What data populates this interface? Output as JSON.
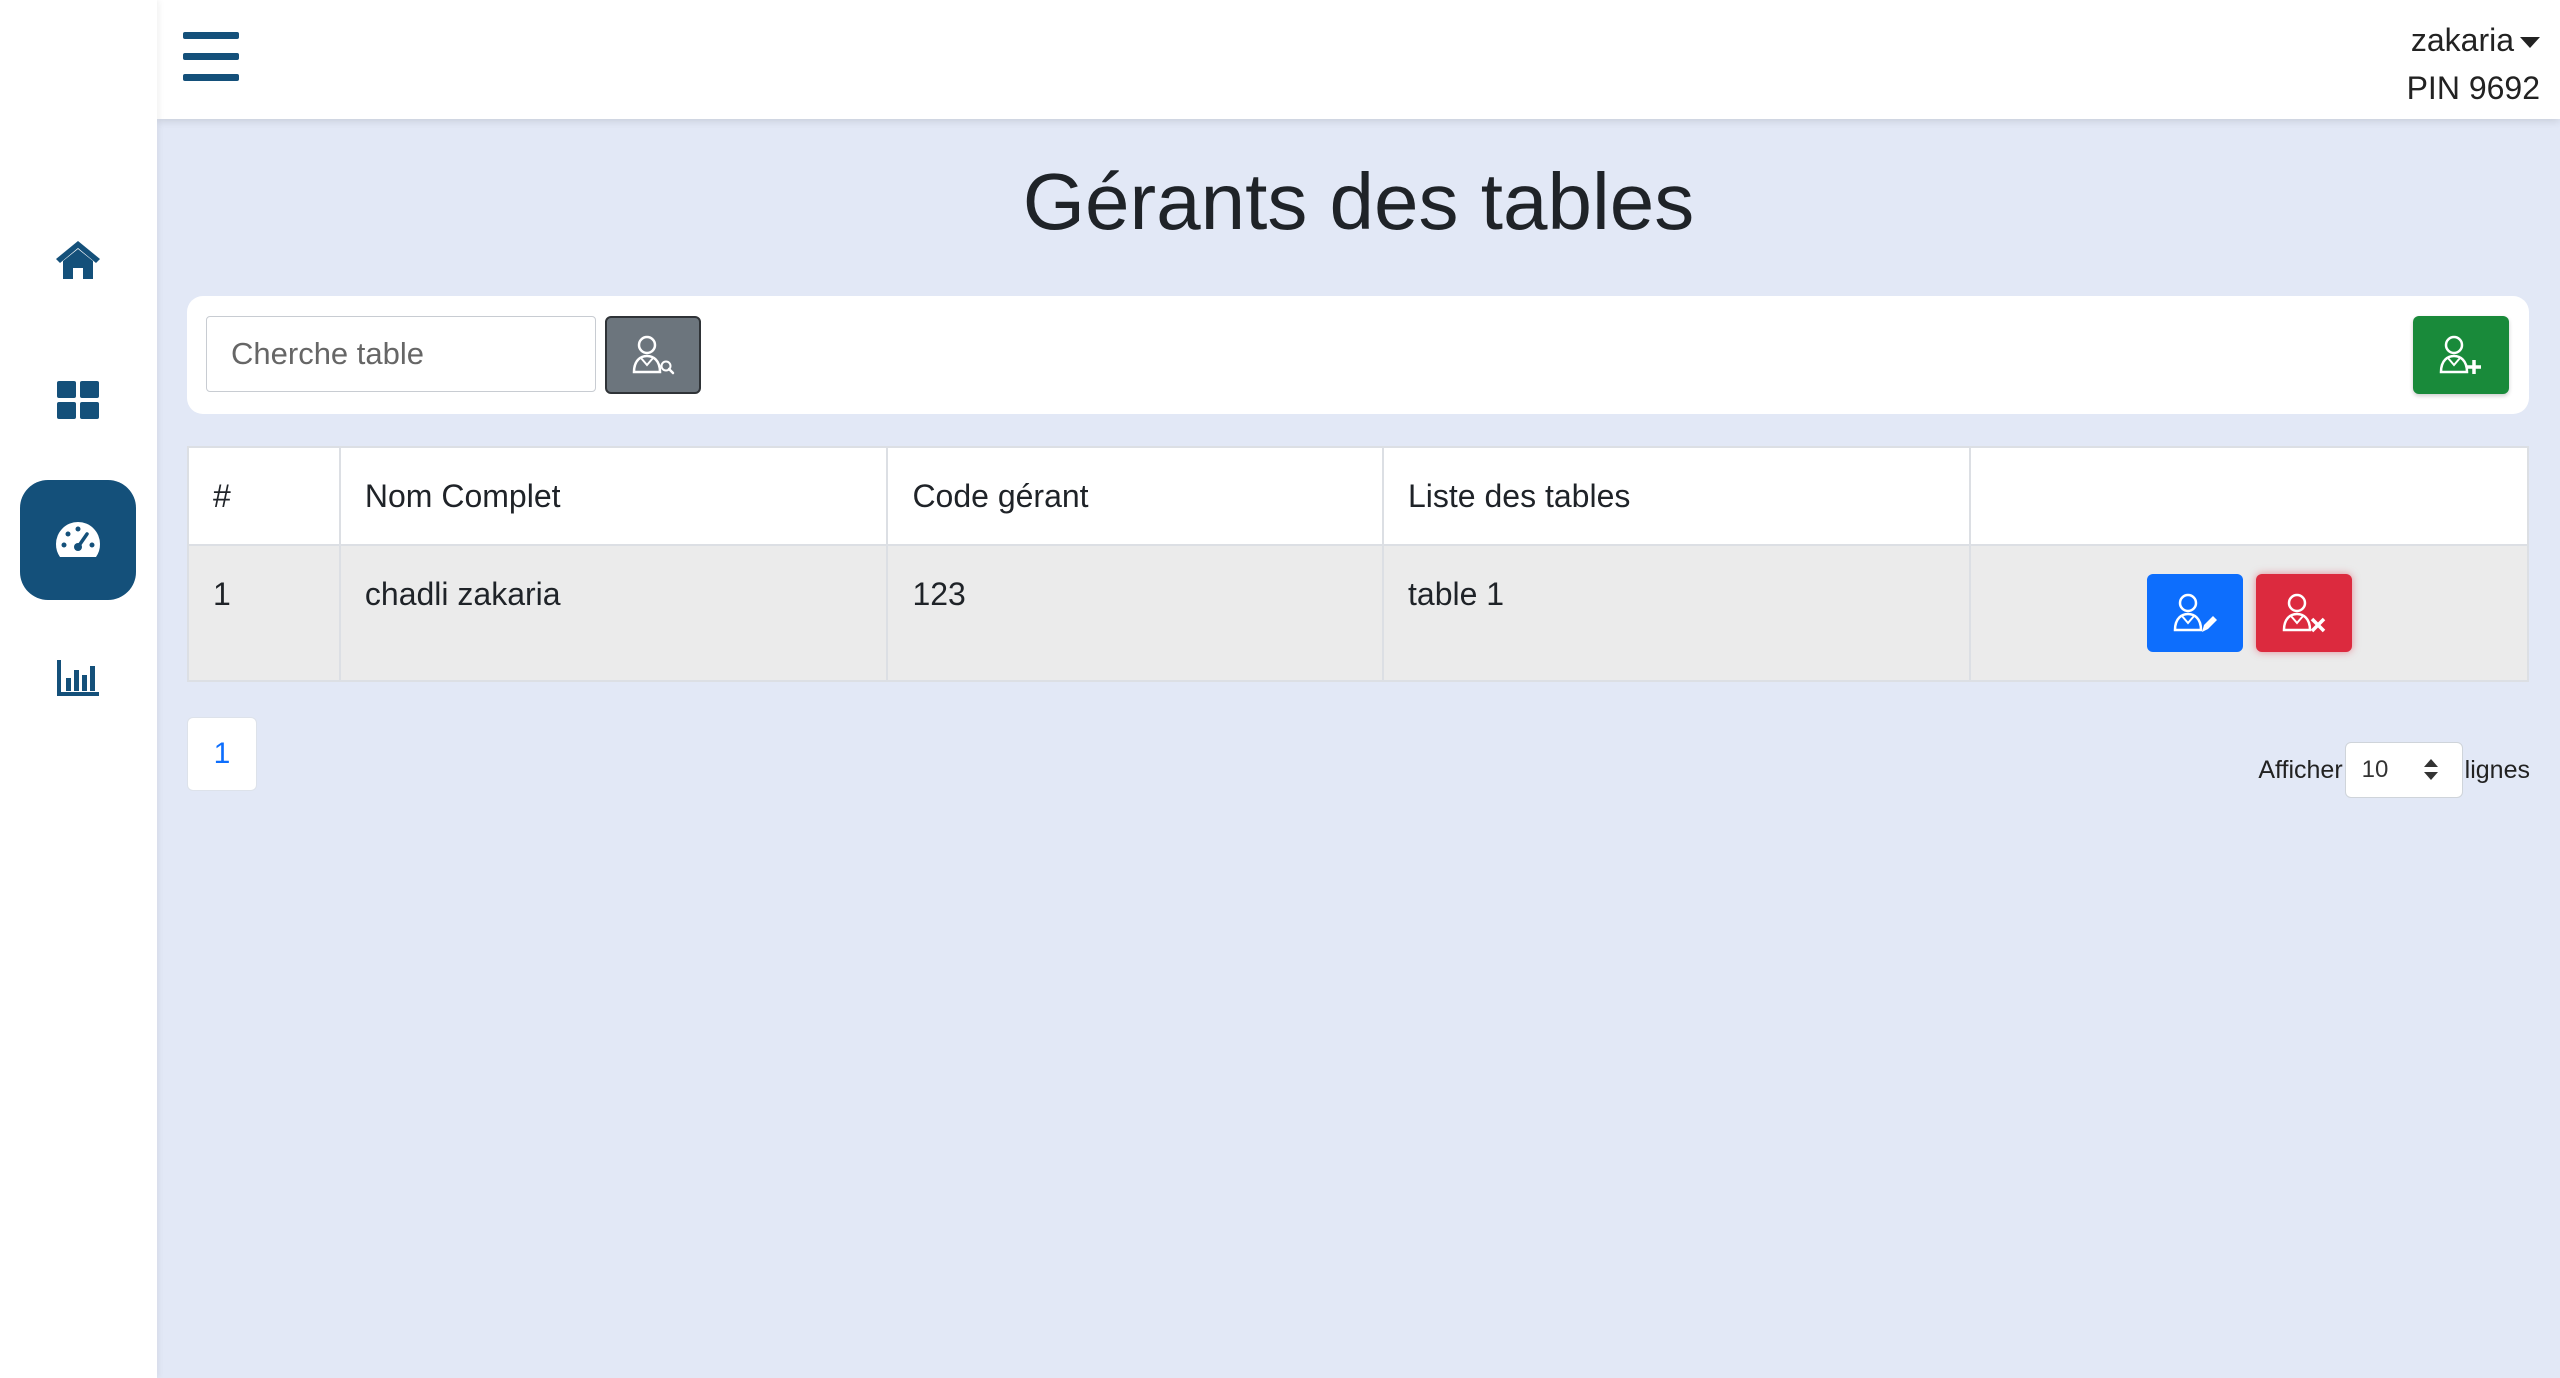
{
  "header": {
    "user_name": "zakaria",
    "pin_label": "PIN 9692"
  },
  "sidebar": {
    "items": [
      {
        "id": "home",
        "icon": "home-icon",
        "active": false
      },
      {
        "id": "dashboard",
        "icon": "grid-icon",
        "active": false
      },
      {
        "id": "gauge",
        "icon": "gauge-icon",
        "active": true
      },
      {
        "id": "stats",
        "icon": "bar-chart-icon",
        "active": false
      }
    ],
    "accent_color": "#14507a"
  },
  "page": {
    "title": "Gérants des tables"
  },
  "toolbar": {
    "search_placeholder": "Cherche table",
    "search_icon": "user-search-icon",
    "add_icon": "user-add-icon"
  },
  "table": {
    "headers": [
      "#",
      "Nom Complet",
      "Code gérant",
      "Liste des tables",
      ""
    ],
    "rows": [
      {
        "index": "1",
        "name": "chadli zakaria",
        "code": "123",
        "tables": "table 1"
      }
    ],
    "edit_icon": "user-edit-icon",
    "delete_icon": "user-delete-icon"
  },
  "pagination": {
    "current_page": "1",
    "show_label": "Afficher",
    "rows_value": "10",
    "rows_label": "lignes"
  },
  "colors": {
    "background": "#e2e8f6",
    "success": "#198a3a",
    "primary": "#0d6efd",
    "danger": "#dc2a3e",
    "secondary": "#6c757d"
  }
}
